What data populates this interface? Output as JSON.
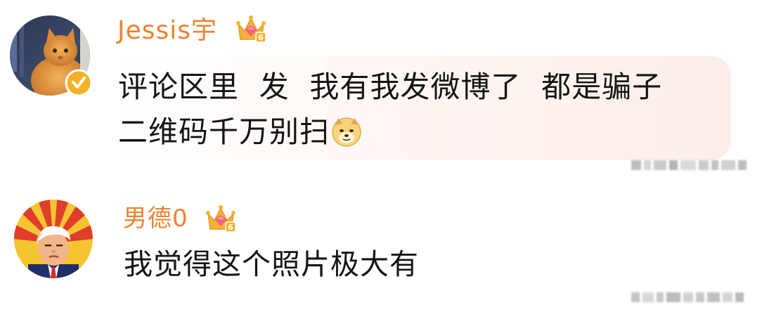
{
  "comments": [
    {
      "username": "Jessis宇",
      "username_color": "#f08230",
      "avatar": "cat-photo-avatar",
      "verified": true,
      "badge": "crown-level-6-icon",
      "badge_level": "6",
      "lines": [
        "评论区里  发  我有我发微博了  都是骗子",
        "二维码千万别扫"
      ],
      "emoji": "doge-icon",
      "meta": "blurred"
    },
    {
      "username": "男德0",
      "username_color": "#f08230",
      "avatar": "cartoon-man-sunburst-avatar",
      "verified": false,
      "badge": "crown-level-6-icon",
      "badge_level": "6",
      "lines": [
        "我觉得这个照片极大有"
      ],
      "meta": "blurred"
    }
  ],
  "colors": {
    "username": "#f08230",
    "text": "#151515",
    "badge_gold": "#f5b335",
    "badge_pink": "#f0637a",
    "verify": "#f5b026",
    "bubble": "#fdeee9"
  }
}
